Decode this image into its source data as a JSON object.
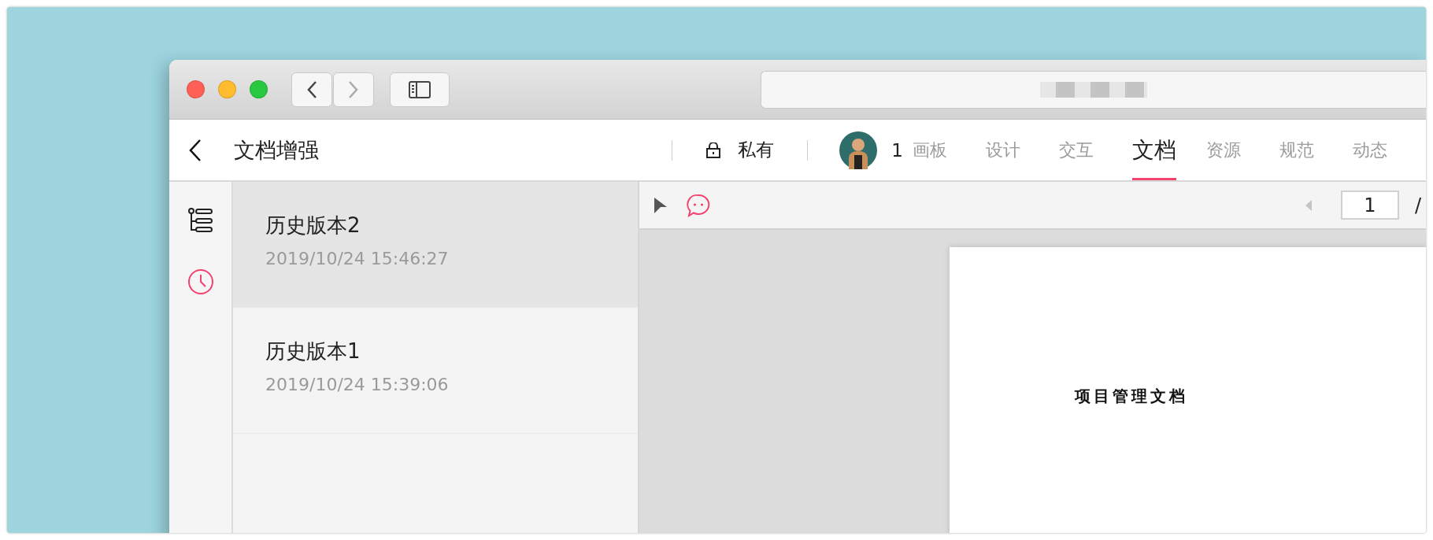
{
  "header": {
    "title": "文档增强",
    "privacy": "私有",
    "member_count": "1",
    "tabs": [
      {
        "label": "画板",
        "selected": false
      },
      {
        "label": "设计",
        "selected": false
      },
      {
        "label": "交互",
        "selected": false
      },
      {
        "label": "文档",
        "selected": true
      },
      {
        "label": "资源",
        "selected": false
      },
      {
        "label": "规范",
        "selected": false
      },
      {
        "label": "动态",
        "selected": false
      }
    ]
  },
  "sidebar": {
    "items": [
      {
        "kind": "outline",
        "selected": false
      },
      {
        "kind": "history",
        "selected": true
      }
    ]
  },
  "versions": [
    {
      "name": "历史版本2",
      "time": "2019/10/24 15:46:27",
      "selected": true
    },
    {
      "name": "历史版本1",
      "time": "2019/10/24 15:39:06",
      "selected": false
    }
  ],
  "toolbar": {
    "tools": [
      {
        "kind": "pointer",
        "selected": false
      },
      {
        "kind": "comment",
        "selected": true
      }
    ],
    "page_number": "1",
    "page_separator": "/"
  },
  "document": {
    "text": "项目管理文档"
  }
}
